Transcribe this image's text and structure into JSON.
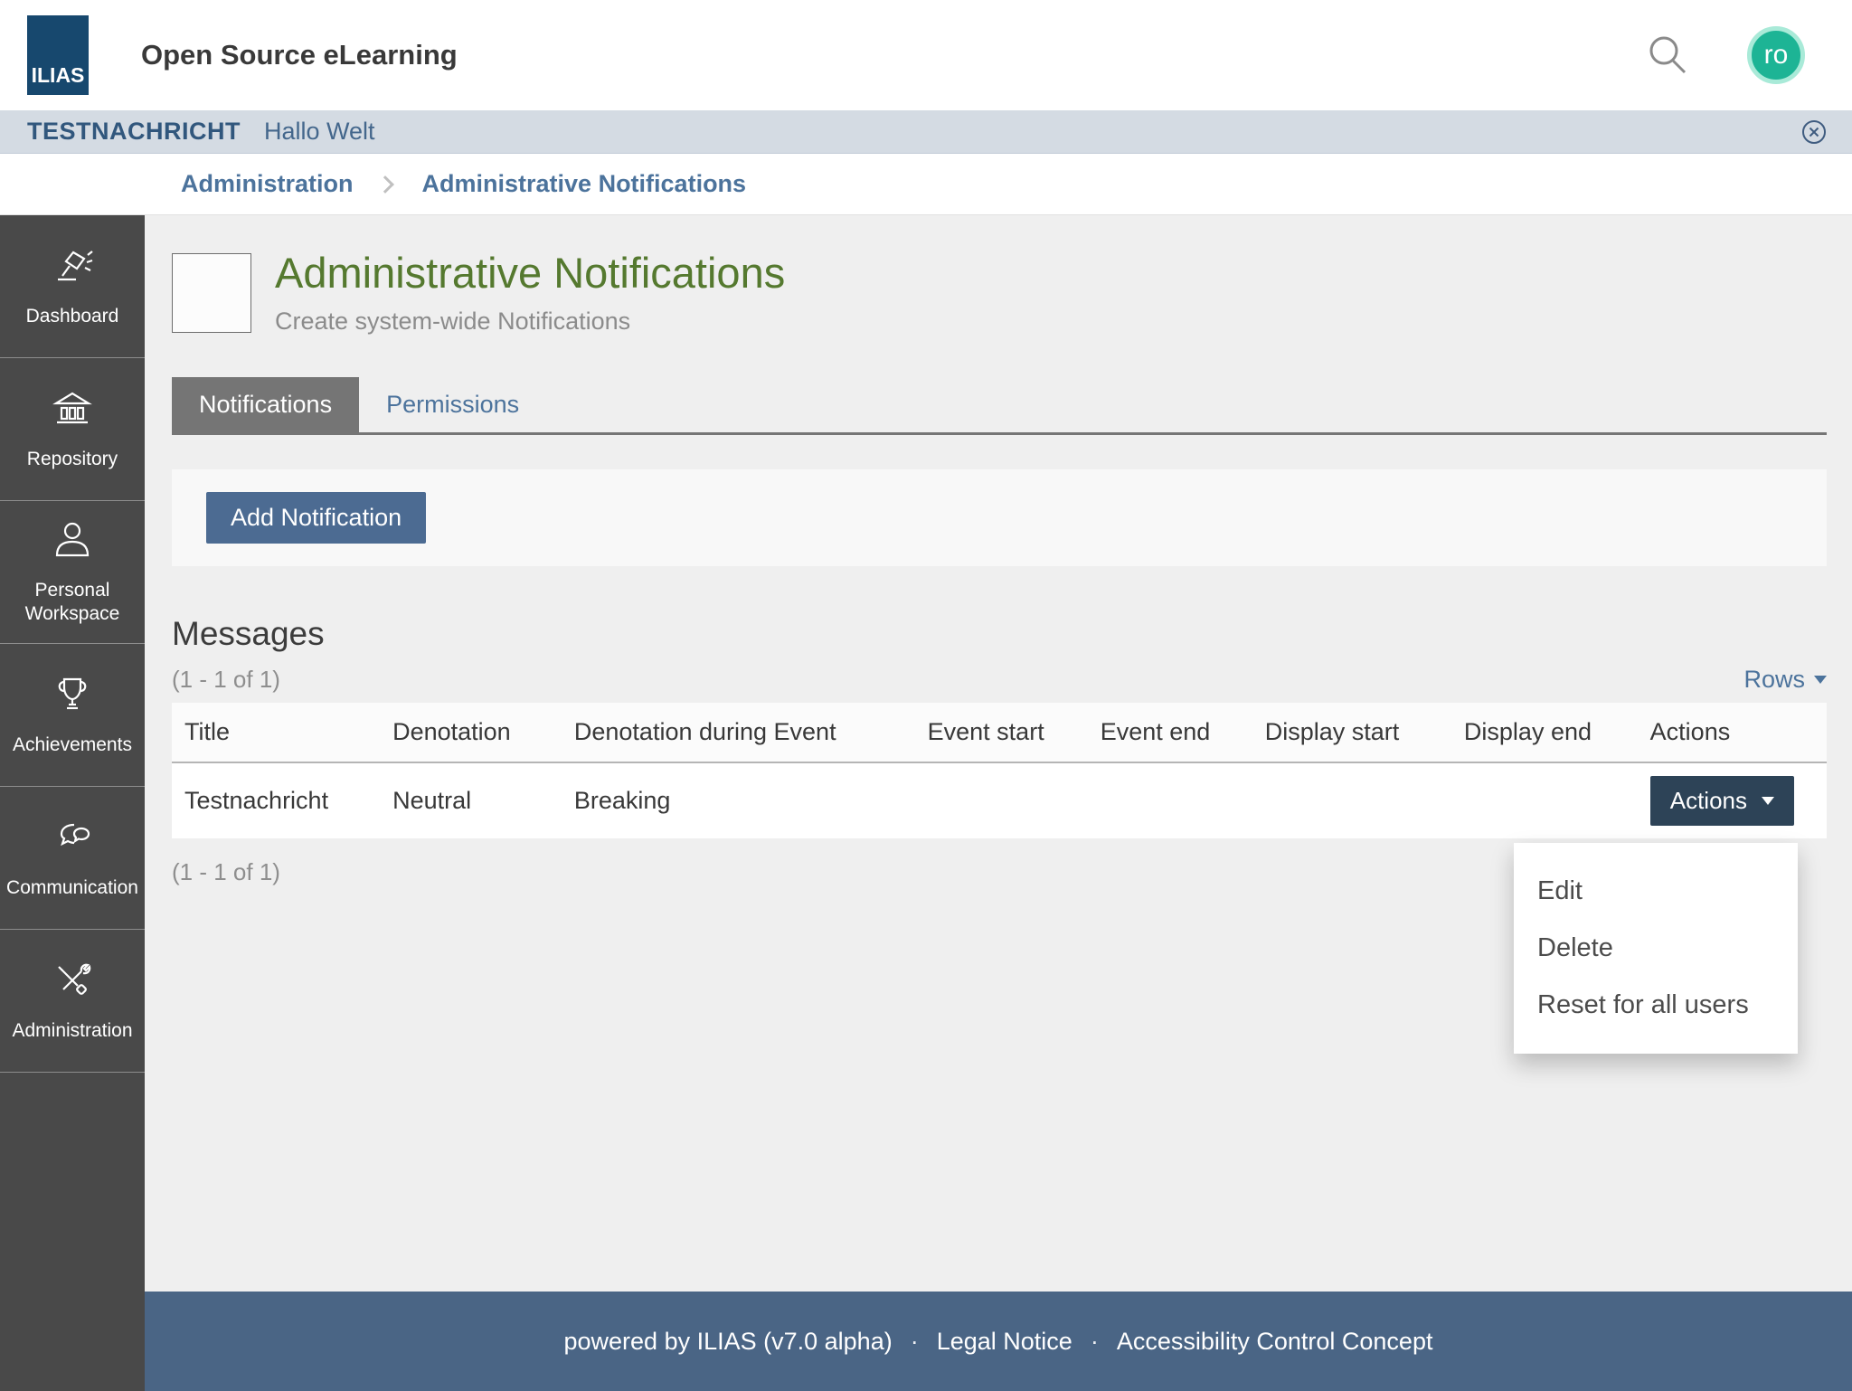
{
  "header": {
    "logo_text": "ILIAS",
    "title": "Open Source eLearning",
    "avatar_initials": "ro"
  },
  "banner": {
    "label": "TESTNACHRICHT",
    "message": "Hallo Welt"
  },
  "breadcrumb": {
    "items": [
      "Administration",
      "Administrative Notifications"
    ]
  },
  "sidebar": {
    "items": [
      {
        "icon": "lamp-icon",
        "label": "Dashboard"
      },
      {
        "icon": "bank-icon",
        "label": "Repository"
      },
      {
        "icon": "person-icon",
        "label": "Personal Workspace"
      },
      {
        "icon": "trophy-icon",
        "label": "Achievements"
      },
      {
        "icon": "chat-bubbles-icon",
        "label": "Communication"
      },
      {
        "icon": "tools-icon",
        "label": "Administration"
      }
    ]
  },
  "page": {
    "title": "Administrative Notifications",
    "subtitle": "Create system-wide Notifications"
  },
  "tabs": [
    {
      "label": "Notifications",
      "active": true
    },
    {
      "label": "Permissions",
      "active": false
    }
  ],
  "toolbar": {
    "add_button": "Add Notification"
  },
  "messages": {
    "heading": "Messages",
    "count_top": "(1 - 1 of 1)",
    "count_bottom": "(1 - 1 of 1)",
    "rows_label": "Rows",
    "table": {
      "columns": [
        "Title",
        "Denotation",
        "Denotation during Event",
        "Event start",
        "Event end",
        "Display start",
        "Display end",
        "Actions"
      ],
      "rows": [
        {
          "title": "Testnachricht",
          "denotation": "Neutral",
          "denotation_during_event": "Breaking",
          "event_start": "",
          "event_end": "",
          "display_start": "",
          "display_end": "",
          "actions_label": "Actions"
        }
      ]
    },
    "dropdown": {
      "items": [
        "Edit",
        "Delete",
        "Reset for all users"
      ]
    }
  },
  "footer": {
    "powered_by": "powered by ILIAS (v7.0 alpha)",
    "separator": "·",
    "links": [
      "Legal Notice",
      "Accessibility Control Concept"
    ]
  },
  "colors": {
    "logo_navy": "#17486e",
    "banner_bg": "#d4dbe3",
    "title_green": "#55792f",
    "sidebar_gray": "#494949",
    "link_blue": "#4c739c",
    "primary_button_blue": "#4c6b92",
    "actions_button_navy": "#2d4357",
    "footer_blue": "#4a6585",
    "avatar_teal": "#1db495",
    "page_bg": "#efefef"
  }
}
